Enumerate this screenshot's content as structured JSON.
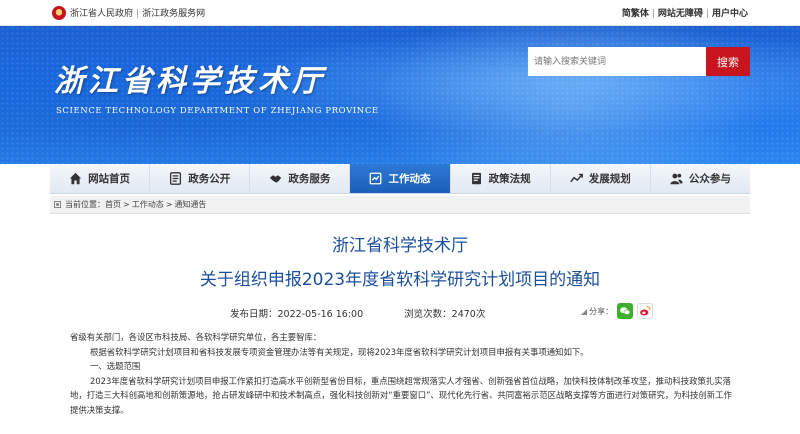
{
  "topbar": {
    "links": [
      "浙江省人民政府",
      "浙江政务服务网"
    ],
    "separator": "|",
    "right": [
      "简繁体",
      "网站无障碍",
      "用户中心"
    ]
  },
  "banner": {
    "title": "浙江省科学技术厅",
    "subtitle": "SCIENCE TECHNOLOGY DEPARTMENT OF ZHEJIANG PROVINCE"
  },
  "search": {
    "placeholder": "请输入搜索关键词",
    "button": "搜索"
  },
  "nav": {
    "items": [
      "网站首页",
      "政务公开",
      "政务服务",
      "工作动态",
      "政策法规",
      "发展规划",
      "公众参与"
    ],
    "active_index": 3
  },
  "breadcrumb": {
    "label": "当前位置：",
    "items": [
      "首页",
      "工作动态",
      "通知通告"
    ],
    "separator": ">"
  },
  "article": {
    "agency": "浙江省科学技术厅",
    "title": "关于组织申报2023年度省软科学研究计划项目的通知",
    "publish_label": "发布日期：",
    "publish_date": "2022-05-16 16:00",
    "views_label": "浏览次数：",
    "views": "2470次",
    "share_label": "分享：",
    "paragraphs": [
      "省级有关部门，各设区市科技局、各软科学研究单位，各主要智库：",
      "根据省软科学研究计划项目和省科技发展专项资金管理办法等有关规定，现将2023年度省软科学研究计划项目申报有关事项通知如下。",
      "一、选题范围",
      "2023年度省软科学研究计划项目申报工作紧扣打造高水平创新型省份目标，重点围绕超常规落实人才强省、创新强省首位战略，加快科技体制改革攻坚，推动科技政策扎实落地，打造三大科创高地和创新策源地，抢占研发峰研中和技术制高点，强化科技创新对“重要窗口”、现代化先行省、共同富裕示范区战略支撑等方面进行对策研究，为科技创新工作提供决策支撑。"
    ]
  },
  "colors": {
    "brand_blue": "#1b4f9c",
    "nav_active": "#2d79d6",
    "search_button": "#c8141e",
    "wechat": "#3fae2a"
  },
  "icons": [
    "emblem-icon",
    "home-icon",
    "document-list-icon",
    "handshake-icon",
    "work-news-icon",
    "policy-book-icon",
    "plan-flow-icon",
    "people-icon",
    "location-pin-icon",
    "wechat-icon",
    "weibo-icon"
  ]
}
